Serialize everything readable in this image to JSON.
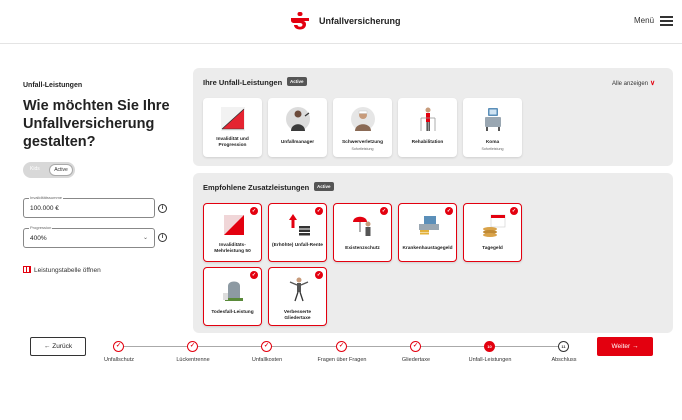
{
  "header": {
    "title": "Unfallversicherung",
    "menu_label": "Menü"
  },
  "sidebar": {
    "section_label": "Unfall-Leistungen",
    "headline": "Wie möchten Sie Ihre Unfallversicherung gestalten?",
    "toggle": {
      "off_label": "Kids",
      "on_label": "Active"
    },
    "invalidity_sum": {
      "label": "Invaliditätssumme",
      "value": "100.000 €"
    },
    "progression": {
      "label": "Progression",
      "value": "400%"
    },
    "table_link": "Leistungstabelle öffnen"
  },
  "my_benefits": {
    "title": "Ihre Unfall-Leistungen",
    "badge": "Active",
    "show_all": "Alle anzeigen",
    "cards": [
      {
        "name": "Invalidität und Progression",
        "sub": ""
      },
      {
        "name": "Unfallmanager",
        "sub": ""
      },
      {
        "name": "Schwerverletzung",
        "sub": "Sofortleistung"
      },
      {
        "name": "Rehabilitation",
        "sub": ""
      },
      {
        "name": "Koma",
        "sub": "Sofortleistung"
      }
    ]
  },
  "recommended": {
    "title": "Empfohlene Zusatzleistungen",
    "badge": "Active",
    "cards": [
      {
        "name": "Invaliditäts-Mehrleistung 50",
        "selected": true
      },
      {
        "name": "(Erhöhte) Unfall-Rente",
        "selected": true
      },
      {
        "name": "Existenzschutz",
        "selected": true
      },
      {
        "name": "Krankenhaustagegeld",
        "selected": true
      },
      {
        "name": "Tagegeld",
        "selected": true
      },
      {
        "name": "Todesfall-Leistung",
        "selected": true
      },
      {
        "name": "Verbesserte Gliedertaxe",
        "selected": true
      }
    ]
  },
  "footer": {
    "back_label": "Zurück",
    "next_label": "Weiter",
    "steps": [
      {
        "label": "Unfallschutz",
        "state": "done",
        "marker": "✓"
      },
      {
        "label": "Lückentrenne",
        "state": "done",
        "marker": "✓"
      },
      {
        "label": "Unfallkosten",
        "state": "done",
        "marker": "✓"
      },
      {
        "label": "Fragen über Fragen",
        "state": "done",
        "marker": "✓"
      },
      {
        "label": "Gliedertaxe",
        "state": "done",
        "marker": "✓"
      },
      {
        "label": "Unfall-Leistungen",
        "state": "current",
        "marker": "10"
      },
      {
        "label": "Abschluss",
        "state": "upcoming",
        "marker": "11"
      }
    ]
  },
  "colors": {
    "brand": "#e3000f",
    "panel": "#ececec",
    "text": "#222222"
  }
}
